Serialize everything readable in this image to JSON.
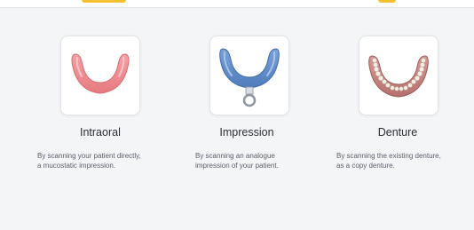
{
  "options": [
    {
      "title": "Intraoral",
      "desc_line1": "By scanning your patient directly,",
      "desc_line2": "a mucostatic impression.",
      "icon": "pink-gum-arch-icon",
      "color": "#ec8a8e"
    },
    {
      "title": "Impression",
      "desc_line1": "By scanning an analogue",
      "desc_line2": "impression of your patient.",
      "icon": "blue-impression-tray-icon",
      "color": "#5b86c4"
    },
    {
      "title": "Denture",
      "desc_line1": "By scanning the existing denture,",
      "desc_line2": "as a copy denture.",
      "icon": "denture-arch-icon",
      "color": "#c98a86"
    }
  ],
  "colors": {
    "accent": "#f2c230",
    "background": "#f4f5f7",
    "card": "#ffffff",
    "text": "#2a2d33",
    "muted": "#5a5f68"
  }
}
